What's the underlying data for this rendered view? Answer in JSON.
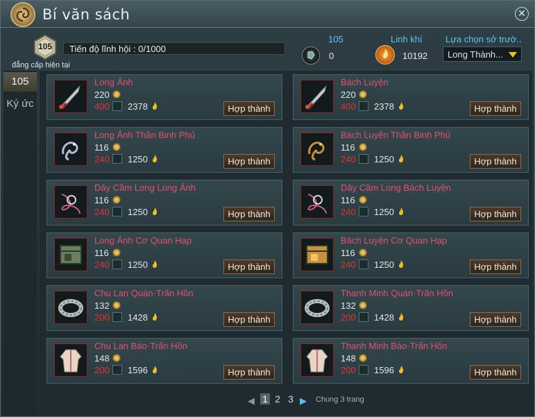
{
  "window": {
    "title": "Bí văn sách"
  },
  "header": {
    "level": "105",
    "level_caption": "đẳng cấp hiện tại",
    "progress_label": "Tiến độ lĩnh hội : 0/1000",
    "stat1": {
      "head": "105",
      "value": "0"
    },
    "stat2": {
      "head": "Linh khí",
      "value": "10192"
    },
    "select": {
      "head": "Lựa chọn sở trườ..",
      "value": "Long Thành..."
    }
  },
  "sidebar": {
    "tabs": [
      {
        "label": "105"
      },
      {
        "label": "Ký ức"
      }
    ]
  },
  "items": [
    {
      "name": "Long Ảnh",
      "cost": "220",
      "req": "400",
      "spirit": "2378",
      "icon": "sword-icon",
      "craft": "Hợp thành"
    },
    {
      "name": "Bách Luyện",
      "cost": "220",
      "req": "400",
      "spirit": "2378",
      "icon": "sword-icon",
      "craft": "Hợp thành"
    },
    {
      "name": "Long Ảnh Thần Binh Phủ",
      "cost": "116",
      "req": "240",
      "spirit": "1250",
      "icon": "dragon-icon",
      "craft": "Hợp thành"
    },
    {
      "name": "Bách Luyện Thần Binh Phủ",
      "cost": "116",
      "req": "240",
      "spirit": "1250",
      "icon": "dragon-icon",
      "craft": "Hợp thành"
    },
    {
      "name": "Dây Cầm Long Long Ảnh",
      "cost": "116",
      "req": "240",
      "spirit": "1250",
      "icon": "cord-icon",
      "craft": "Hợp thành"
    },
    {
      "name": "Dây Cầm Long Bách Luyện",
      "cost": "116",
      "req": "240",
      "spirit": "1250",
      "icon": "cord-icon",
      "craft": "Hợp thành"
    },
    {
      "name": "Long Ảnh Cơ Quan Hạp",
      "cost": "116",
      "req": "240",
      "spirit": "1250",
      "icon": "box-icon",
      "craft": "Hợp thành"
    },
    {
      "name": "Bách Luyện Cơ Quan Hạp",
      "cost": "116",
      "req": "240",
      "spirit": "1250",
      "icon": "box-icon",
      "craft": "Hợp thành"
    },
    {
      "name": "Chu Lan Quán·Trấn Hồn",
      "cost": "132",
      "req": "200",
      "spirit": "1428",
      "icon": "bracelet-icon",
      "craft": "Hợp thành"
    },
    {
      "name": "Thanh Minh Quán·Trấn Hồn",
      "cost": "132",
      "req": "200",
      "spirit": "1428",
      "icon": "bracelet-icon",
      "craft": "Hợp thành"
    },
    {
      "name": "Chu Lan Bào·Trấn Hồn",
      "cost": "148",
      "req": "200",
      "spirit": "1596",
      "icon": "robe-icon",
      "craft": "Hợp thành"
    },
    {
      "name": "Thanh Minh Bào·Trấn Hồn",
      "cost": "148",
      "req": "200",
      "spirit": "1596",
      "icon": "robe-icon",
      "craft": "Hợp thành"
    }
  ],
  "pager": {
    "pages": [
      "1",
      "2",
      "3"
    ],
    "current": "1",
    "total_label": "Chung 3 trang"
  },
  "colors": {
    "item_name": "#e2506e",
    "requirement": "#e3332f",
    "stat_head": "#62c4f0"
  }
}
